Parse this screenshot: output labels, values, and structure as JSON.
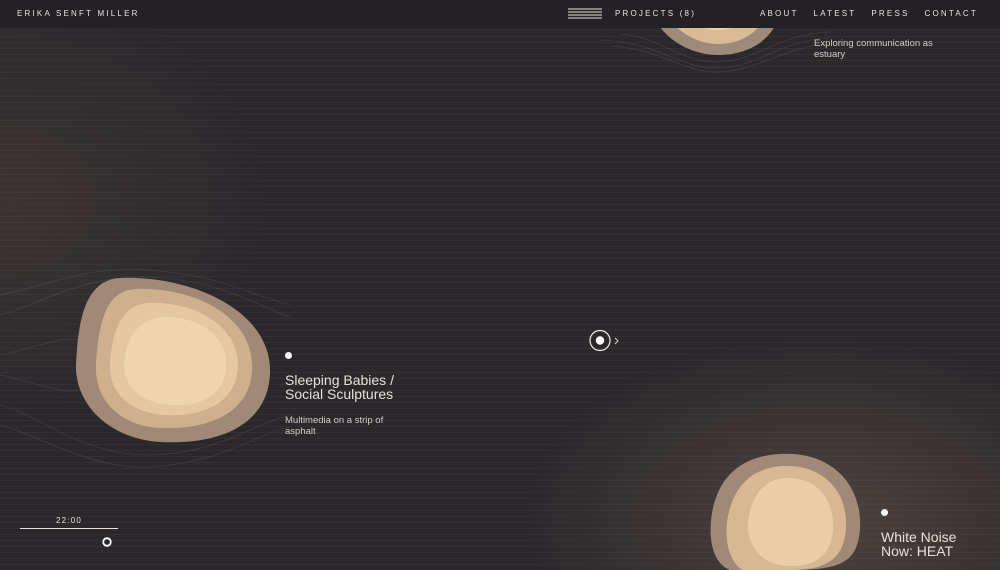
{
  "header": {
    "brand": "ERIKA SENFT MILLER",
    "projects_label": "PROJECTS (8)",
    "nav": [
      "ABOUT",
      "LATEST",
      "PRESS",
      "CONTACT"
    ]
  },
  "projects": [
    {
      "title": "",
      "description": "Exploring communication as estuary"
    },
    {
      "title": "Sleeping Babies / Social Sculptures",
      "description": "Multimedia on a strip of asphalt"
    },
    {
      "title": "White Noise Now: HEAT",
      "description": ""
    }
  ],
  "timer": {
    "value": "22:00"
  },
  "icons": {
    "menu": "menu-icon",
    "cursor": "cursor-circle-icon",
    "timer_knob": "timer-knob-icon"
  },
  "colors": {
    "background": "#2b282c",
    "blob_outer": "#a08b78",
    "blob_inner": "#f0d2a8",
    "text": "#e8e2da"
  }
}
